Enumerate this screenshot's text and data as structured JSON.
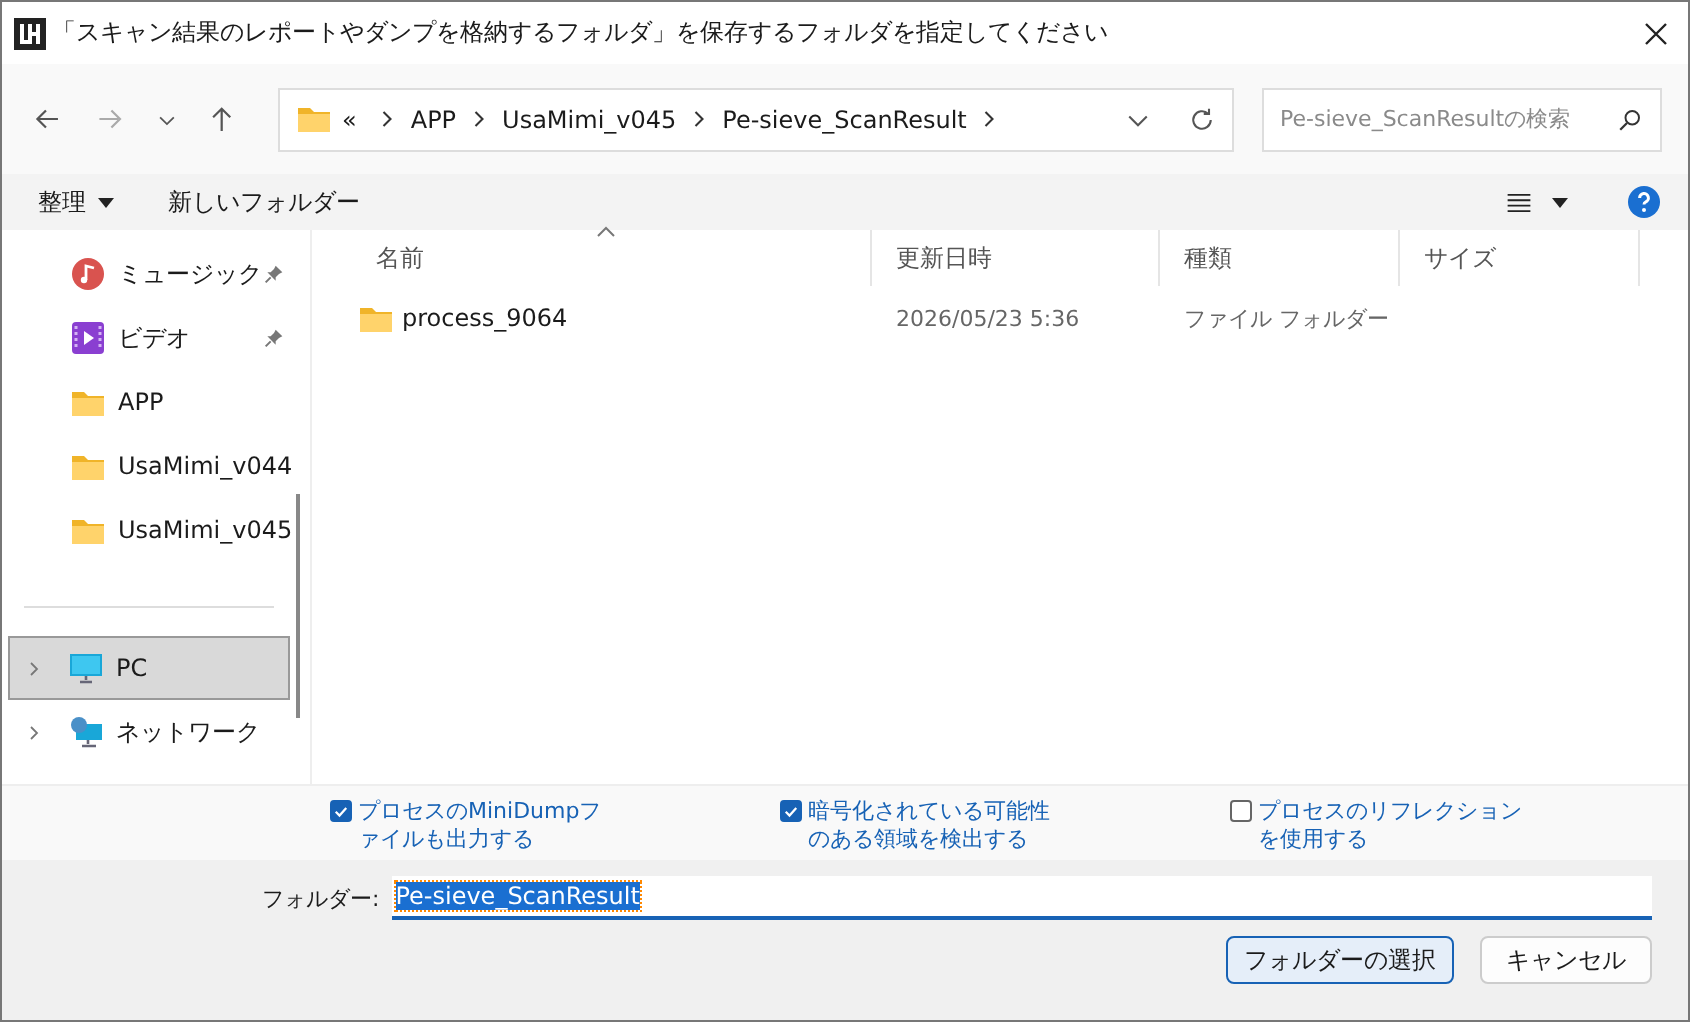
{
  "window": {
    "title": "「スキャン結果のレポートやダンプを格納するフォルダ」を保存するフォルダを指定してください"
  },
  "address": {
    "overflow": "«",
    "crumbs": [
      "APP",
      "UsaMimi_v045",
      "Pe-sieve_ScanResult"
    ]
  },
  "search": {
    "placeholder": "Pe-sieve_ScanResultの検索"
  },
  "toolbar": {
    "organize": "整理",
    "new_folder": "新しいフォルダー"
  },
  "sidebar": {
    "quick": [
      {
        "kind": "music",
        "label": "ミュージック",
        "pinned": true
      },
      {
        "kind": "video",
        "label": "ビデオ",
        "pinned": true
      },
      {
        "kind": "folder",
        "label": "APP",
        "pinned": false
      },
      {
        "kind": "folder",
        "label": "UsaMimi_v044",
        "pinned": false
      },
      {
        "kind": "folder",
        "label": "UsaMimi_v045",
        "pinned": false
      }
    ],
    "nav": [
      {
        "kind": "pc",
        "label": "PC",
        "selected": true
      },
      {
        "kind": "network",
        "label": "ネットワーク",
        "selected": false
      }
    ]
  },
  "table": {
    "columns": [
      {
        "label": "名前",
        "sorted": true
      },
      {
        "label": "更新日時",
        "sorted": false
      },
      {
        "label": "種類",
        "sorted": false
      },
      {
        "label": "サイズ",
        "sorted": false
      }
    ],
    "rows": [
      {
        "name": "process_9064",
        "modified": "2026/05/23 5:36",
        "type": "ファイル フォルダー"
      }
    ]
  },
  "options": [
    {
      "label": "プロセスのMiniDumpファイルも出力する",
      "checked": true
    },
    {
      "label": "暗号化されている可能性のある領域を検出する",
      "checked": true
    },
    {
      "label": "プロセスのリフレクションを使用する",
      "checked": false
    }
  ],
  "folder_field": {
    "label": "フォルダー:",
    "value": "Pe-sieve_ScanResult"
  },
  "buttons": [
    {
      "label": "フォルダーの選択",
      "kind": "primary"
    },
    {
      "label": "キャンセル",
      "kind": "secondary"
    }
  ]
}
